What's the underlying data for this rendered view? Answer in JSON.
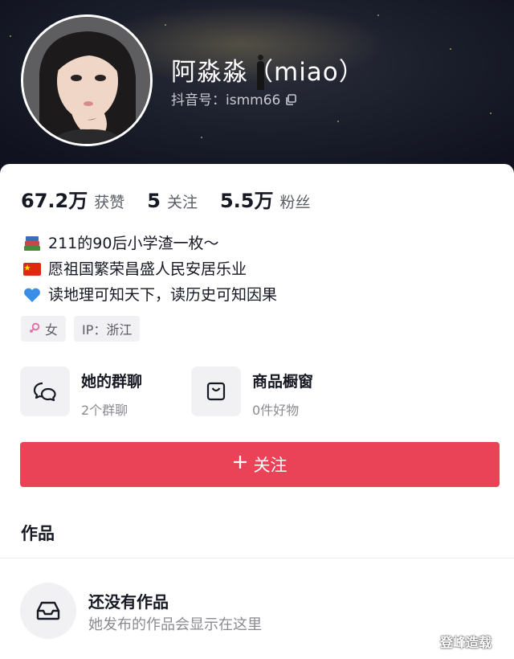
{
  "profile": {
    "nickname": "阿淼淼（miao）",
    "douyin_id_label": "抖音号：ismm66"
  },
  "stats": [
    {
      "value": "67.2万",
      "label": "获赞"
    },
    {
      "value": "5",
      "label": "关注"
    },
    {
      "value": "5.5万",
      "label": "粉丝"
    }
  ],
  "bio": [
    {
      "icon": "books-emoji",
      "text": "211的90后小学渣一枚～"
    },
    {
      "icon": "china-flag-emoji",
      "text": "愿祖国繁荣昌盛人民安居乐业"
    },
    {
      "icon": "blue-heart-emoji",
      "text": "读地理可知天下，读历史可知因果"
    }
  ],
  "tags": {
    "gender": "女",
    "ip": "IP：浙江"
  },
  "entries": {
    "group_chat": {
      "title": "她的群聊",
      "subtitle": "2个群聊"
    },
    "shop_window": {
      "title": "商品橱窗",
      "subtitle": "0件好物"
    }
  },
  "follow_button": {
    "label": "关注",
    "color": "#ea4358"
  },
  "works": {
    "title": "作品",
    "empty_title": "还没有作品",
    "empty_subtitle": "她发布的作品会显示在这里"
  },
  "watermark": "登峰造载"
}
